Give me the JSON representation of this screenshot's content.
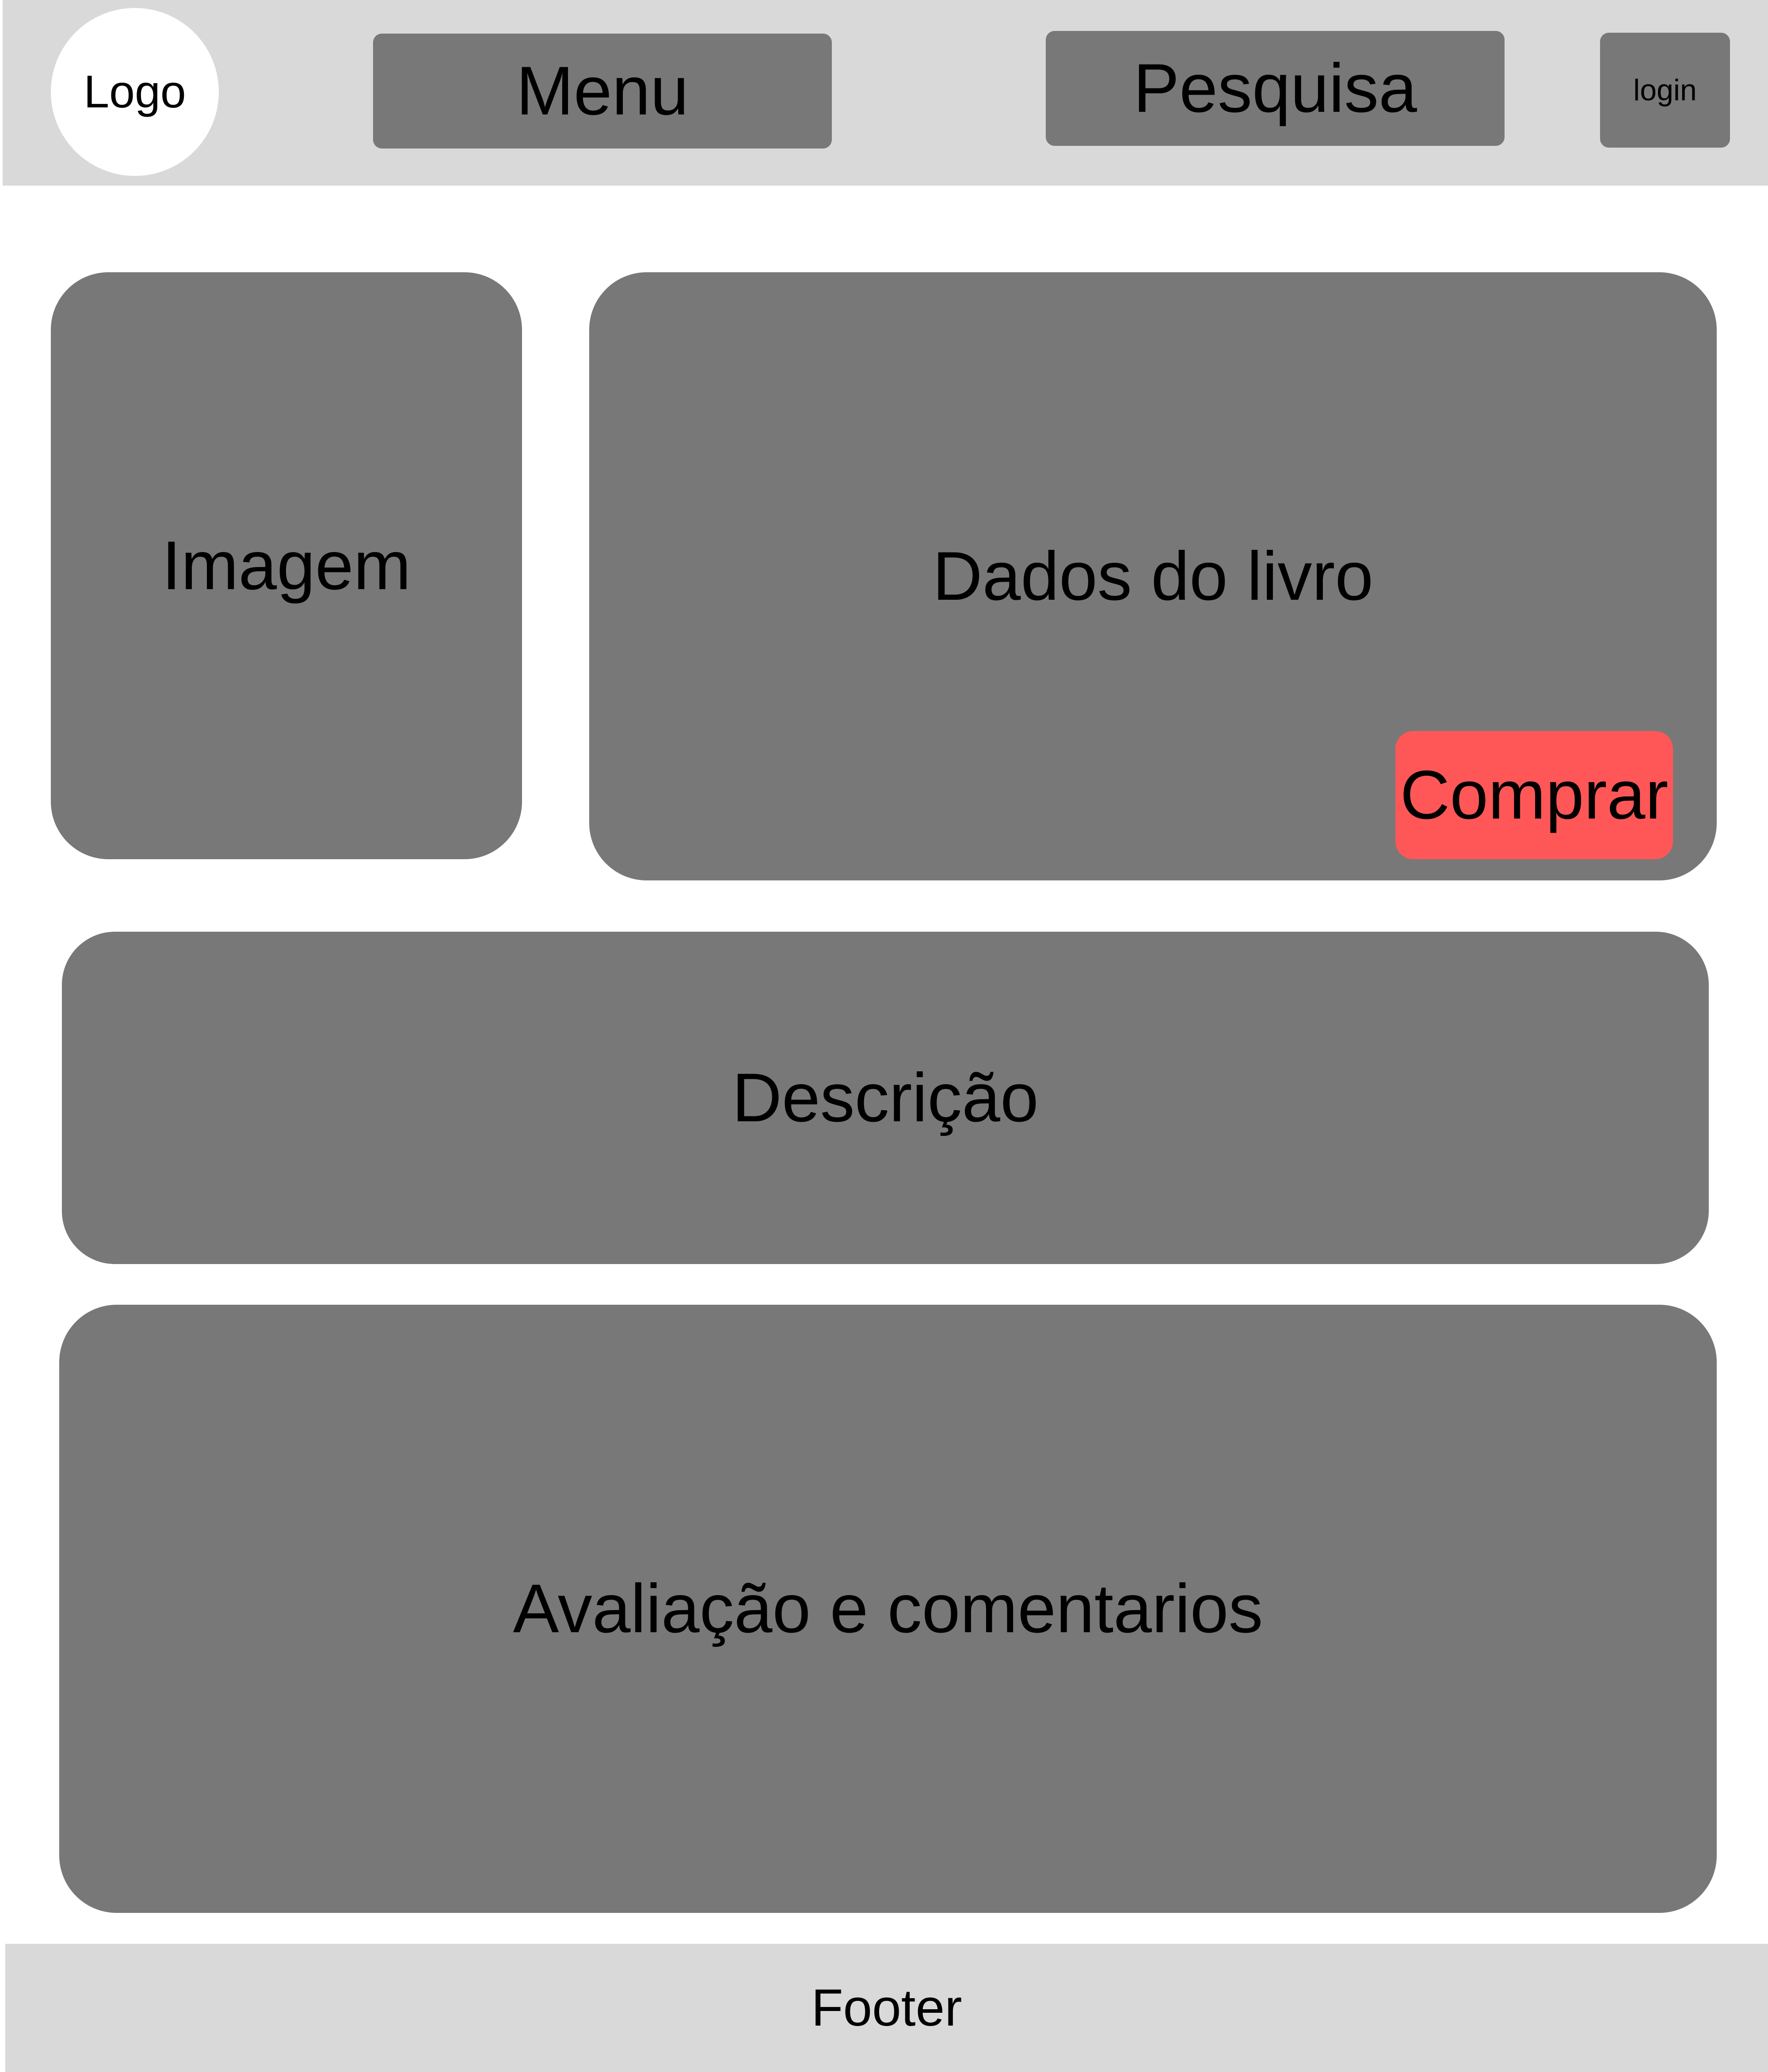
{
  "header": {
    "logo_label": "Logo",
    "menu_label": "Menu",
    "search_label": "Pesquisa",
    "login_label": "login"
  },
  "main": {
    "image_label": "Imagem",
    "book_data_label": "Dados do livro",
    "buy_label": "Comprar",
    "description_label": "Descrição",
    "reviews_label": "Avaliação e comentarios"
  },
  "footer": {
    "label": "Footer"
  },
  "colors": {
    "bar_background": "#d9d9d9",
    "panel_background": "#787878",
    "buy_button": "#ff5757",
    "logo_background": "#ffffff",
    "text": "#000000"
  }
}
